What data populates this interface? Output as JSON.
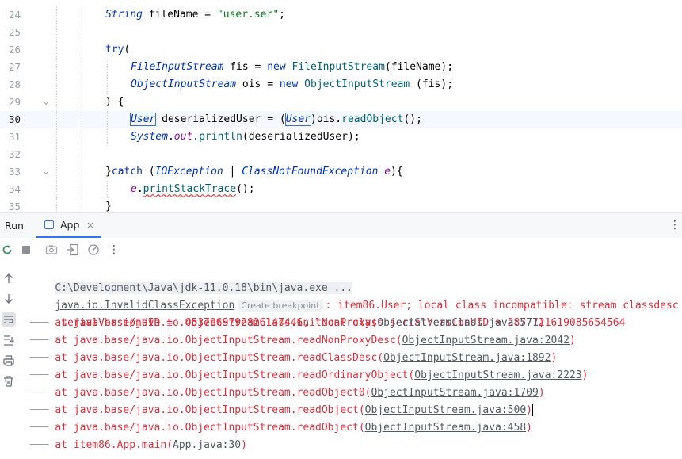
{
  "editor": {
    "lines": [
      {
        "num": "24",
        "indent": 2,
        "tokens": [
          {
            "t": "String",
            "c": "type"
          },
          {
            "t": " fileName = ",
            "c": "var"
          },
          {
            "t": "\"user.ser\"",
            "c": "str"
          },
          {
            "t": ";",
            "c": "var"
          }
        ]
      },
      {
        "num": "25",
        "indent": 2,
        "tokens": []
      },
      {
        "num": "26",
        "indent": 2,
        "tokens": [
          {
            "t": "try",
            "c": "kw"
          },
          {
            "t": "(",
            "c": "var"
          }
        ]
      },
      {
        "num": "27",
        "indent": 3,
        "tokens": [
          {
            "t": "FileInputStream",
            "c": "type"
          },
          {
            "t": " fis = ",
            "c": "var"
          },
          {
            "t": "new",
            "c": "kw"
          },
          {
            "t": " ",
            "c": "var"
          },
          {
            "t": "FileInputStream",
            "c": "fn"
          },
          {
            "t": "(fileName);",
            "c": "var"
          }
        ]
      },
      {
        "num": "28",
        "indent": 3,
        "tokens": [
          {
            "t": "ObjectInputStream",
            "c": "type"
          },
          {
            "t": " ois = ",
            "c": "var"
          },
          {
            "t": "new",
            "c": "kw"
          },
          {
            "t": " ",
            "c": "var"
          },
          {
            "t": "ObjectInputStream",
            "c": "fn"
          },
          {
            "t": " (fis);",
            "c": "var"
          }
        ]
      },
      {
        "num": "29",
        "indent": 2,
        "fold": true,
        "tokens": [
          {
            "t": ") {",
            "c": "var"
          }
        ]
      },
      {
        "num": "30",
        "indent": 3,
        "current": true,
        "tokens": [
          {
            "t": "User",
            "c": "type boxed"
          },
          {
            "t": " deserializedUser = (",
            "c": "var"
          },
          {
            "t": "User",
            "c": "type boxed"
          },
          {
            "t": ")ois.",
            "c": "var"
          },
          {
            "t": "readObject",
            "c": "fn"
          },
          {
            "t": "();",
            "c": "var"
          }
        ]
      },
      {
        "num": "31",
        "indent": 3,
        "tokens": [
          {
            "t": "System",
            "c": "type"
          },
          {
            "t": ".",
            "c": "var"
          },
          {
            "t": "out",
            "c": "fld"
          },
          {
            "t": ".",
            "c": "var"
          },
          {
            "t": "println",
            "c": "fn"
          },
          {
            "t": "(deserializedUser);",
            "c": "var"
          }
        ]
      },
      {
        "num": "32",
        "indent": 2,
        "tokens": []
      },
      {
        "num": "33",
        "indent": 2,
        "fold": true,
        "tokens": [
          {
            "t": "}",
            "c": "var"
          },
          {
            "t": "catch",
            "c": "kw"
          },
          {
            "t": " (",
            "c": "var"
          },
          {
            "t": "IOException",
            "c": "type"
          },
          {
            "t": " | ",
            "c": "var"
          },
          {
            "t": "ClassNotFoundException",
            "c": "type"
          },
          {
            "t": " ",
            "c": "var"
          },
          {
            "t": "e",
            "c": "param"
          },
          {
            "t": "){",
            "c": "var"
          }
        ]
      },
      {
        "num": "34",
        "indent": 3,
        "tokens": [
          {
            "t": "e",
            "c": "param"
          },
          {
            "t": ".",
            "c": "var"
          },
          {
            "t": "printStackTrace",
            "c": "fn err-underline"
          },
          {
            "t": "();",
            "c": "var"
          }
        ]
      },
      {
        "num": "35",
        "indent": 2,
        "tokens": [
          {
            "t": "}",
            "c": "var"
          }
        ]
      }
    ]
  },
  "run_panel": {
    "title": "Run",
    "tab_label": "App",
    "tab_close": "×",
    "more": "⋮"
  },
  "toolbar_icons": [
    "rerun-icon",
    "stop-icon",
    "camera-icon",
    "restore-layout-icon",
    "coverage-icon",
    "more-icon"
  ],
  "side_icons": [
    "scroll-up-icon",
    "scroll-down-icon",
    "soft-wrap-icon",
    "scroll-to-end-icon",
    "print-icon",
    "clear-icon"
  ],
  "console": {
    "command": "C:\\Development\\Java\\jdk-11.0.18\\bin\\java.exe ...",
    "exception_class": "java.io.InvalidClassException",
    "breakpoint_hint": "Create breakpoint",
    "exception_message": ": item86.User; local class incompatible: stream classdesc",
    "exception_cont": " serialVersionUID = -4537969792826147446, local class serialVersionUID = 2877721619085654564",
    "frames": [
      {
        "prefix": "at java.base/java.io.ObjectStreamClass.initNonProxy(",
        "link": "ObjectStreamClass.java:571",
        "suffix": ")"
      },
      {
        "prefix": "at java.base/java.io.ObjectInputStream.readNonProxyDesc(",
        "link": "ObjectInputStream.java:2042",
        "suffix": ")"
      },
      {
        "prefix": "at java.base/java.io.ObjectInputStream.readClassDesc(",
        "link": "ObjectInputStream.java:1892",
        "suffix": ")"
      },
      {
        "prefix": "at java.base/java.io.ObjectInputStream.readOrdinaryObject(",
        "link": "ObjectInputStream.java:2223",
        "suffix": ")"
      },
      {
        "prefix": "at java.base/java.io.ObjectInputStream.readObject0(",
        "link": "ObjectInputStream.java:1709",
        "suffix": ")"
      },
      {
        "prefix": "at java.base/java.io.ObjectInputStream.readObject(",
        "link": "ObjectInputStream.java:500",
        "suffix": ")"
      },
      {
        "prefix": "at java.base/java.io.ObjectInputStream.readObject(",
        "link": "ObjectInputStream.java:458",
        "suffix": ")"
      },
      {
        "prefix": "at item86.App.main(",
        "link": "App.java:30",
        "suffix": ")"
      }
    ]
  }
}
